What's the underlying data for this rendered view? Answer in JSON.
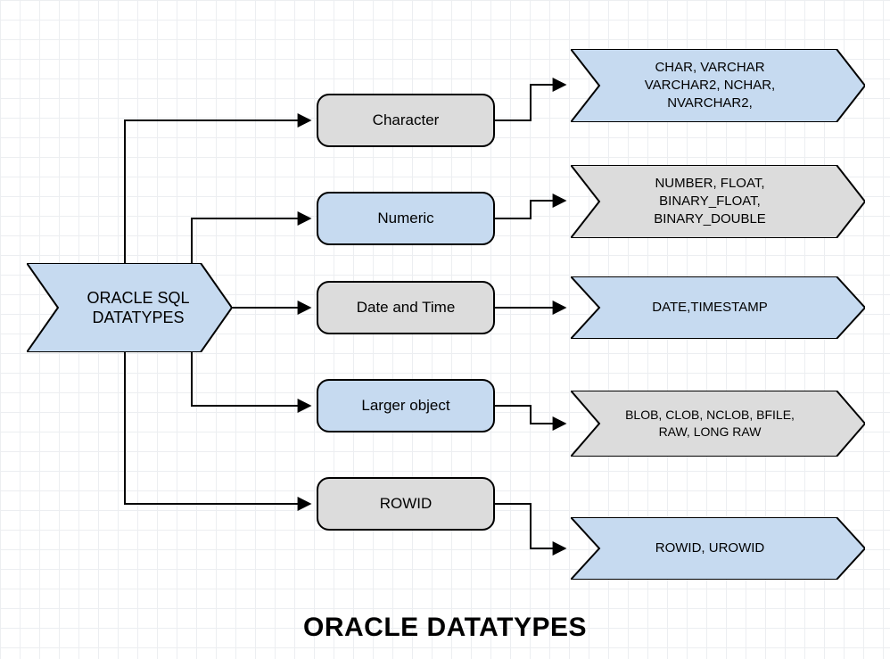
{
  "title": "ORACLE DATATYPES",
  "root": "ORACLE SQL\nDATATYPES",
  "categories": [
    {
      "name": "Character",
      "types": "CHAR, VARCHAR\nVARCHAR2, NCHAR,\nNVARCHAR2,"
    },
    {
      "name": "Numeric",
      "types": "NUMBER, FLOAT,\nBINARY_FLOAT,\nBINARY_DOUBLE"
    },
    {
      "name": "Date and Time",
      "types": "DATE,TIMESTAMP"
    },
    {
      "name": "Larger object",
      "types": "BLOB, CLOB, NCLOB, BFILE,\nRAW, LONG RAW"
    },
    {
      "name": "ROWID",
      "types": "ROWID, UROWID"
    }
  ],
  "colors": {
    "blueFill": "#c6daf0",
    "grayFill": "#dcdcdc",
    "stroke": "#000000"
  }
}
